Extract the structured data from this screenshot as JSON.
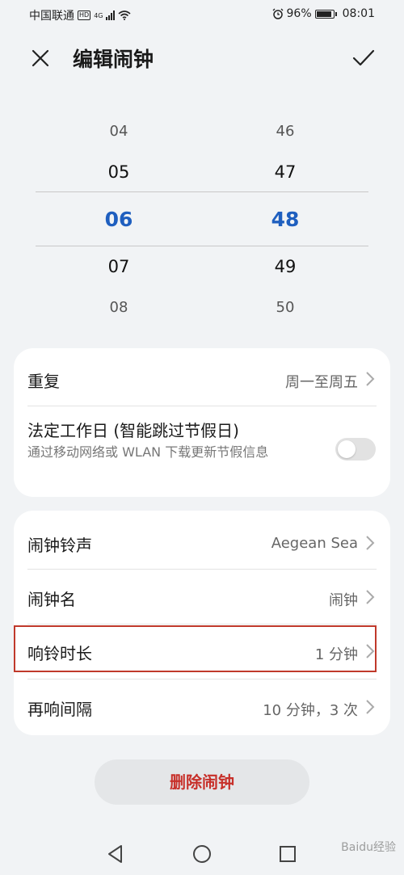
{
  "status_bar": {
    "carrier": "中国联通",
    "hd_badge": "HD",
    "network": "4G",
    "battery_text": "96%",
    "battery_level": 0.96,
    "time": "08:01"
  },
  "header": {
    "title": "编辑闹钟",
    "close_icon": "close-icon",
    "confirm_icon": "check-icon"
  },
  "picker": {
    "hours": [
      "04",
      "05",
      "06",
      "07",
      "08"
    ],
    "minutes": [
      "46",
      "47",
      "48",
      "49",
      "50"
    ],
    "selected_hour": "06",
    "selected_minute": "48",
    "accent": "#1f5fbf"
  },
  "repeat_card": {
    "repeat_label": "重复",
    "repeat_value": "周一至周五",
    "workday_label": "法定工作日 (智能跳过节假日)",
    "workday_desc": "通过移动网络或 WLAN 下载更新节假信息",
    "workday_enabled": false
  },
  "settings_card": {
    "ringtone_label": "闹钟铃声",
    "ringtone_value": "Aegean Sea",
    "name_label": "闹钟名",
    "name_value": "闹钟",
    "duration_label": "响铃时长",
    "duration_value": "1 分钟",
    "snooze_label": "再响间隔",
    "snooze_value": "10 分钟，3 次"
  },
  "highlight_color": "#c0392b",
  "delete_label": "删除闹钟",
  "delete_color": "#c7302a",
  "navbar": {
    "back_icon": "back-triangle-icon",
    "home_icon": "home-circle-icon",
    "recent_icon": "recent-square-icon"
  },
  "watermark": "Baidu经验"
}
